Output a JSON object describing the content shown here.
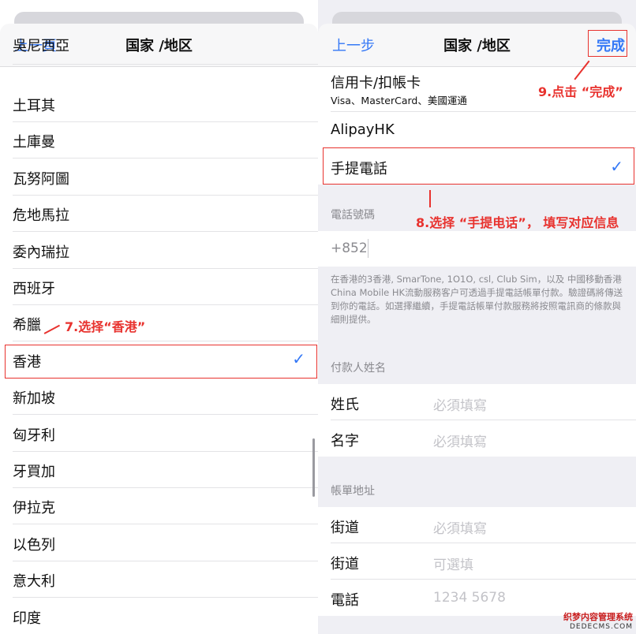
{
  "left": {
    "nav": {
      "back": "上一頁",
      "title": "国家 /地区"
    },
    "partial_top": "吳尼西亞",
    "countries": [
      "土耳其",
      "土庫曼",
      "瓦努阿圖",
      "危地馬拉",
      "委內瑞拉",
      "西班牙",
      "希臘",
      "香港",
      "新加坡",
      "匈牙利",
      "牙買加",
      "伊拉克",
      "以色列",
      "意大利",
      "印度"
    ],
    "selected": "香港",
    "annotation": "7.选择“香港”"
  },
  "right": {
    "nav": {
      "back": "上一步",
      "title": "国家 /地区",
      "done": "完成"
    },
    "payment": {
      "card_label": "信用卡/扣帳卡",
      "card_sub": "Visa、MasterCard、美國運通",
      "alipay": "AlipayHK",
      "mobile": "手提電話"
    },
    "phone": {
      "header": "電話號碼",
      "prefix": "+852",
      "note": "在香港的3香港, SmarTone, 1O1O, csl, Club Sim，以及 中國移動香港 China Mobile HK流動服務客户可透過手提電話帳單付款。驗證碼將傳送到你的電話。如選擇繼續，手提電話帳單付款服務將按照電訊商的條款與細則提供。"
    },
    "payer": {
      "header": "付款人姓名",
      "surname": {
        "label": "姓氏",
        "placeholder": "必須填寫"
      },
      "given": {
        "label": "名字",
        "placeholder": "必須填寫"
      }
    },
    "billing": {
      "header": "帳單地址",
      "street1": {
        "label": "街道",
        "placeholder": "必須填寫"
      },
      "street2": {
        "label": "街道",
        "placeholder": "可選填"
      },
      "phone": {
        "label": "電話",
        "placeholder": "1234 5678"
      }
    },
    "annotation_done": "9.点击 “完成”",
    "annotation_mobile": "8.选择 “手提电话”， 填写对应信息"
  },
  "watermark": {
    "line1": "织梦内容管理系统",
    "line2": "DEDECMS.COM"
  },
  "colors": {
    "accent": "#3478f6",
    "annotation": "#e8322e"
  }
}
